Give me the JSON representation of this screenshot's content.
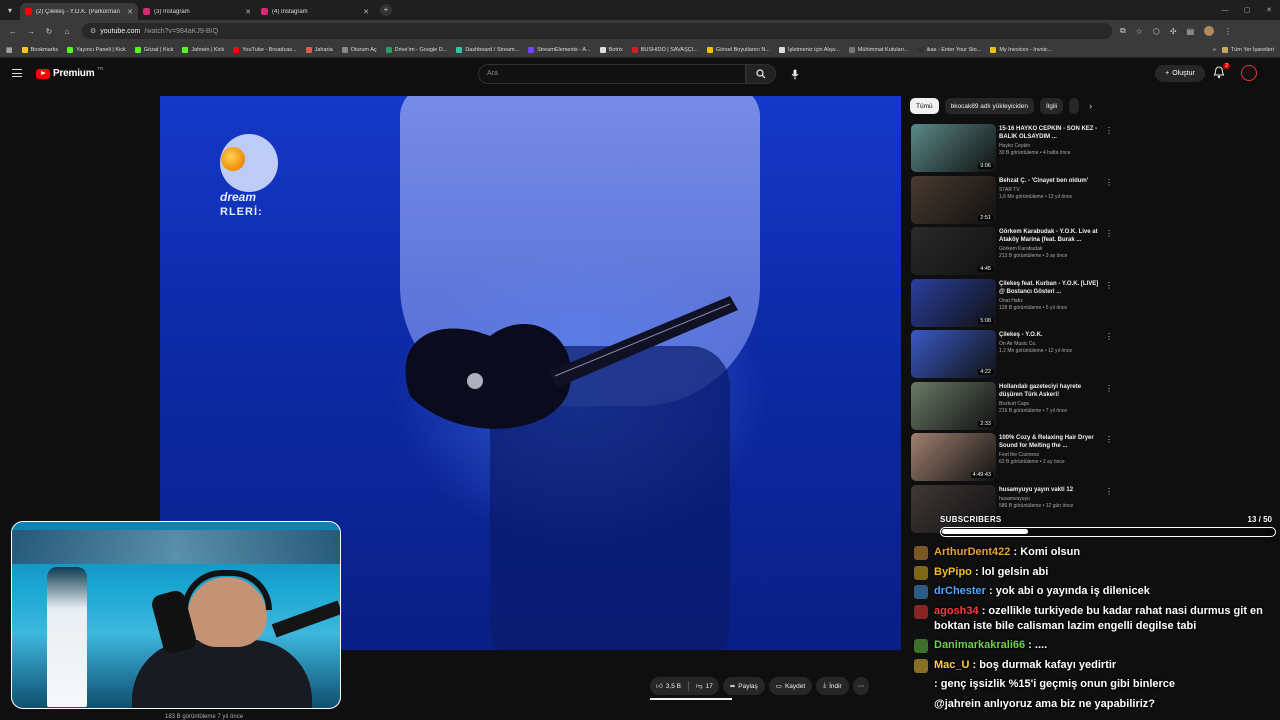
{
  "browser": {
    "tabs": [
      {
        "title": "(2) Çilekeş - Y.O.K. (Parkorman",
        "active": true,
        "favicon_color": "#ff0000"
      },
      {
        "title": "(3) Instagram",
        "active": false,
        "favicon_color": "#d62976"
      },
      {
        "title": "(4) Instagram",
        "active": false,
        "favicon_color": "#d62976"
      }
    ],
    "url_host": "youtube.com",
    "url_path": "/watch?v=984aKJ9-BIQ",
    "bookmarks": [
      {
        "label": "Bookmarks",
        "color": "#f5c518"
      },
      {
        "label": "Yayıncı Paneli | Kick",
        "color": "#53fc18"
      },
      {
        "label": "Gözat | Kick",
        "color": "#53fc18"
      },
      {
        "label": "Jahrein | Kick",
        "color": "#53fc18"
      },
      {
        "label": "YouTube - Broadcas...",
        "color": "#ff0000"
      },
      {
        "label": "Jaharia",
        "color": "#e05a47"
      },
      {
        "label": "Oturum Aç",
        "color": "#888888"
      },
      {
        "label": "Drive'ım - Google D...",
        "color": "#1fa463"
      },
      {
        "label": "Dashboard / Stream...",
        "color": "#32c3a6"
      },
      {
        "label": "StreamElements - A...",
        "color": "#6c47ff"
      },
      {
        "label": "Botrix",
        "color": "#dddddd"
      },
      {
        "label": "BUSHIDO | SAVAŞÇI...",
        "color": "#cc2222"
      },
      {
        "label": "Görsel Boyutlarını N...",
        "color": "#f2c200"
      },
      {
        "label": "İşletmeniz için Alışv...",
        "color": "#dddddd"
      },
      {
        "label": "Mühimmat Kutuları...",
        "color": "#777777"
      },
      {
        "label": "ikas - Enter Your Sto...",
        "color": "#333333"
      },
      {
        "label": "My Invoices - Invoic...",
        "color": "#f0c000"
      }
    ],
    "bookmarks_all": "Tüm Yer İşaretleri"
  },
  "youtube": {
    "logo_text": "Premium",
    "logo_region": "TR",
    "search_placeholder": "Ara",
    "create_label": "Oluştur",
    "notif_count": "2",
    "chips": [
      "Tümü",
      "bkocak89 adlı yükleyiciden",
      "İlgili"
    ],
    "actions": {
      "likes": "3,5 B",
      "dislikes": "17",
      "share": "Paylaş",
      "save": "Kaydet",
      "download": "İndir"
    },
    "views_line": "183 B görüntüleme  7 yıl önce",
    "recommendations": [
      {
        "title": "15-16 HAYKO CEPKİN - SON KEZ - BALIK OLSAYDIM ...",
        "channel": "Hayko Cepkin",
        "stats": "30 B görüntüleme • 4 hafta önce",
        "duration": "9:06",
        "thumb": "#5a8a88"
      },
      {
        "title": "Behzat Ç. - 'Cinayet ben oldum'",
        "channel": "STAR TV",
        "stats": "1,6 Mn görüntüleme • 13 yıl önce",
        "duration": "2:51",
        "thumb": "#4a3a30"
      },
      {
        "title": "Görkem Karabudak - Y.O.K. Live at Ataköy Marina (feat. Burak ...",
        "channel": "Görkem Karabudak",
        "stats": "213 B görüntüleme • 3 ay önce",
        "duration": "4:45",
        "thumb": "#2a2a2a"
      },
      {
        "title": "Çilekeş feat. Kurban - Y.O.K. [LIVE] @ Bostancı Gösteri ...",
        "channel": "Onat Hafız",
        "stats": "128 B görüntüleme • 5 yıl önce",
        "duration": "5:08",
        "thumb": "#2a3fa0"
      },
      {
        "title": "Çilekeş - Y.O.K.",
        "channel": "On Air Music Co.",
        "stats": "1,2 Mn görüntüleme • 12 yıl önce",
        "duration": "4:22",
        "thumb": "#3a5ac8"
      },
      {
        "title": "Hollandalı gazeteciyi hayrete düşüren Türk Askeri!",
        "channel": "Bozkurt Caps",
        "stats": "219 B görüntüleme • 7 yıl önce",
        "duration": "2:33",
        "thumb": "#6a7a68"
      },
      {
        "title": "100% Cozy & Relaxing Hair Dryer Sound for Melting the ...",
        "channel": "Feel the Coziness",
        "stats": "63 B görüntüleme • 2 ay önce",
        "duration": "4:49:43",
        "thumb": "#a08070"
      },
      {
        "title": "husamyuyu yayın vakti 12",
        "channel": "husamvuyuyu",
        "stats": "586 B görüntüleme • 12 gün önce",
        "duration": "",
        "thumb": "#403838"
      }
    ]
  },
  "overlay": {
    "subs_label": "SUBSCRIBERS",
    "subs_count": "13 / 50",
    "subs_progress": 0.26,
    "chat": [
      {
        "user": "ArthurDent422",
        "user_color": "#e6a23c",
        "text": "Komi olsun"
      },
      {
        "user": "ByPipo",
        "user_color": "#f0c020",
        "text": "lol gelsin abi"
      },
      {
        "user": "drChester",
        "user_color": "#4fa8ff",
        "text": "yok abi o yayında iş dilenicek"
      },
      {
        "user": "agosh34",
        "user_color": "#ff3b3b",
        "text": "ozellikle turkiyede bu kadar rahat nasi durmus git en boktan iste bile calisman lazim engelli degilse tabi"
      },
      {
        "user": "Danimarkakrali66",
        "user_color": "#6fd14a",
        "text": "...."
      },
      {
        "user": "Mac_U",
        "user_color": "#ffd23a",
        "text": "boş durmak kafayı yedirtir"
      },
      {
        "user": "",
        "user_color": "#ffffff",
        "text": "genç işsizlik %15'i geçmiş onun gibi binlerce"
      },
      {
        "user": "",
        "user_color": "#ffffff",
        "text": "@jahrein anlıyoruz ama biz ne yapabiliriz?"
      }
    ]
  },
  "video": {
    "channel_brand": "dream",
    "channel_sub": "RLERİ:"
  }
}
